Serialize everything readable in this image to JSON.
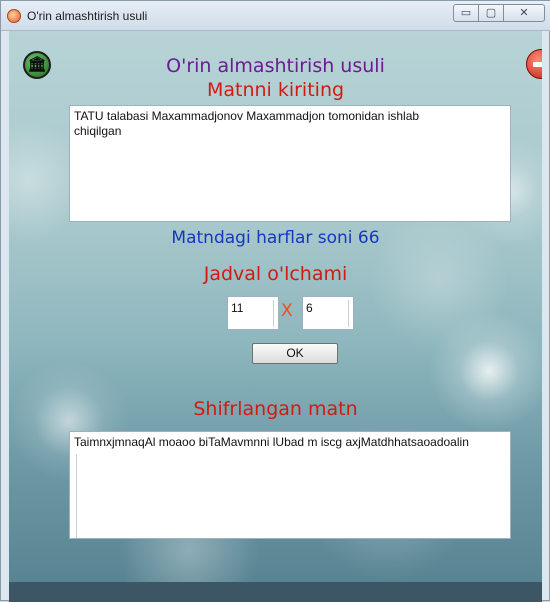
{
  "window": {
    "title": "O'rin almashtirish usuli",
    "caption_buttons": {
      "minimize": "▭",
      "maximize": "▢",
      "close": "✕"
    }
  },
  "header": {
    "app_title": "O'rin almashtirish usuli",
    "back_icon": "🏛",
    "exit_icon": "exit-icon"
  },
  "input_section": {
    "heading": "Matnni kiriting",
    "text": "TATU talabasi Maxammadjonov Maxammadjon tomonidan ishlab\nchiqilgan"
  },
  "letter_count": {
    "text": "Matndagi harflar soni 66"
  },
  "table_size": {
    "heading": "Jadval o'lchami",
    "rows_value": "11",
    "separator": "X",
    "cols_value": "6",
    "ok_label": "OK"
  },
  "cipher_section": {
    "heading": "Shifrlangan matn",
    "text": "TaimnxjmnaqAl moaoo biTaMavmnni lUbad m iscg axjMatdhhatsaoadoalin"
  },
  "colors": {
    "title_purple": "#6b1c8f",
    "heading_red": "#d21a12",
    "count_blue": "#1637c0",
    "x_orange": "#e8501c"
  }
}
